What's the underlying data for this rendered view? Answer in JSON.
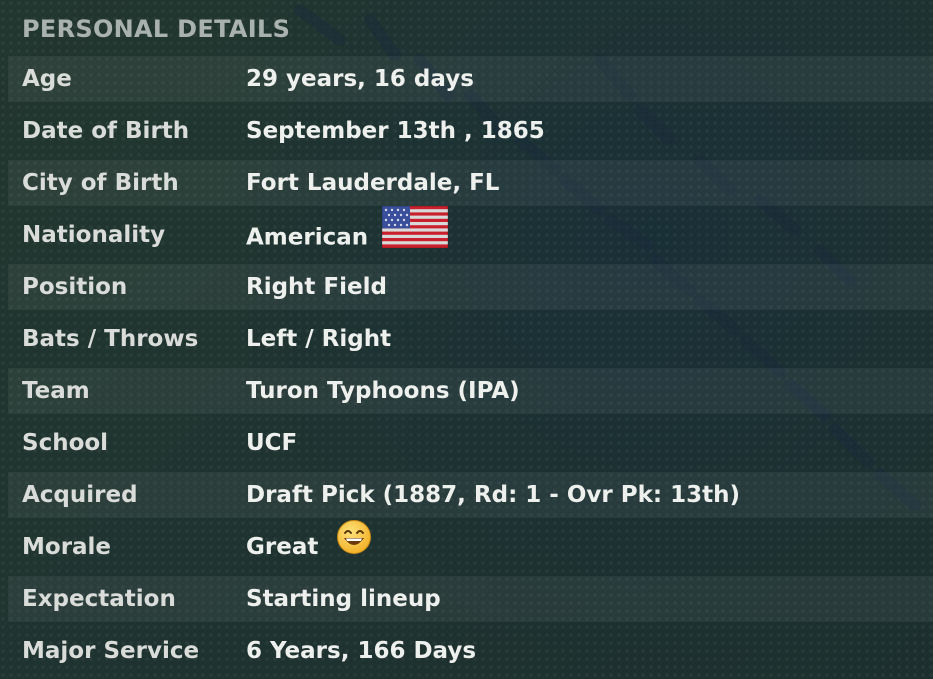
{
  "header": {
    "title": "PERSONAL DETAILS"
  },
  "rows": [
    {
      "label": "Age",
      "value": "29 years, 16 days"
    },
    {
      "label": "Date of Birth",
      "value": "September 13th , 1865"
    },
    {
      "label": "City of Birth",
      "value": "Fort Lauderdale, FL"
    },
    {
      "label": "Nationality",
      "value": "American",
      "icon": "us-flag-icon"
    },
    {
      "label": "Position",
      "value": "Right Field"
    },
    {
      "label": "Bats / Throws",
      "value": "Left / Right"
    },
    {
      "label": "Team",
      "value": "Turon Typhoons (IPA)"
    },
    {
      "label": "School",
      "value": "UCF"
    },
    {
      "label": "Acquired",
      "value": "Draft Pick (1887, Rd: 1 - Ovr Pk: 13th)"
    },
    {
      "label": "Morale",
      "value": "Great",
      "icon": "grinning-face-icon"
    },
    {
      "label": "Expectation",
      "value": "Starting lineup"
    },
    {
      "label": "Major Service",
      "value": "6 Years, 166 Days"
    }
  ],
  "colors": {
    "background": "#203430",
    "header_text": "#a9b2ae",
    "row_text": "#eef0ee",
    "stitch": "#182a3a"
  }
}
